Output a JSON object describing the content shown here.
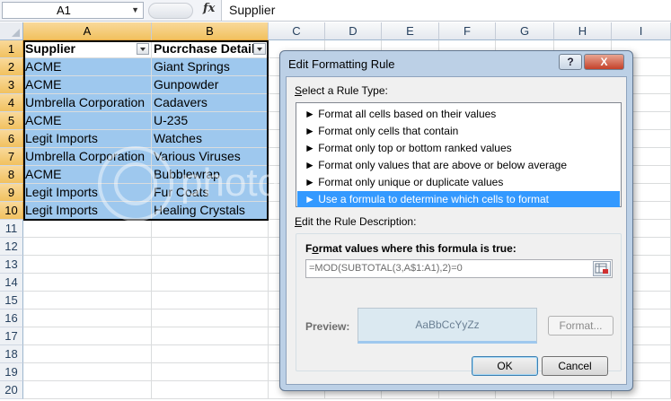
{
  "formula_bar": {
    "name_box": "A1",
    "fx": "fx",
    "formula": "Supplier"
  },
  "grid": {
    "columns": [
      "A",
      "B",
      "C",
      "D",
      "E",
      "F",
      "G",
      "H",
      "I"
    ],
    "rows": [
      "1",
      "2",
      "3",
      "4",
      "5",
      "6",
      "7",
      "8",
      "9",
      "10",
      "11",
      "12",
      "13",
      "14",
      "15",
      "16",
      "17",
      "18",
      "19",
      "20"
    ],
    "headers": [
      "Supplier",
      "Pucrchase Details"
    ],
    "data": [
      [
        "ACME",
        "Giant Springs"
      ],
      [
        "ACME",
        "Gunpowder"
      ],
      [
        "Umbrella Corporation",
        "Cadavers"
      ],
      [
        "ACME",
        "U-235"
      ],
      [
        "Legit Imports",
        "Watches"
      ],
      [
        "Umbrella Corporation",
        "Various Viruses"
      ],
      [
        "ACME",
        "Bubblewrap"
      ],
      [
        "Legit Imports",
        "Fur Coats"
      ],
      [
        "Legit Imports",
        "Healing Crystals"
      ]
    ],
    "band_color": "#9ec8ee"
  },
  "dialog": {
    "title": "Edit Formatting Rule",
    "help": "?",
    "close": "X",
    "select_rule_label_accel": "S",
    "select_rule_label_rest": "elect a Rule Type:",
    "rule_types": [
      "► Format all cells based on their values",
      "► Format only cells that contain",
      "► Format only top or bottom ranked values",
      "► Format only values that are above or below average",
      "► Format only unique or duplicate values",
      "► Use a formula to determine which cells to format"
    ],
    "selected_rule_index": 5,
    "edit_desc_label_accel": "E",
    "edit_desc_label_rest": "dit the Rule Description:",
    "formula_heading_pre": "F",
    "formula_heading_accel": "o",
    "formula_heading_rest": "rmat values where this formula is true:",
    "formula": "=MOD(SUBTOTAL(3,A$1:A1),2)=0",
    "preview_label": "Preview:",
    "preview_sample": "AaBbCcYyZz",
    "format_button": "Format...",
    "ok_button": "OK",
    "cancel_button": "Cancel",
    "selection_color": "#3399ff"
  },
  "watermark": {
    "text": "photobucket"
  }
}
